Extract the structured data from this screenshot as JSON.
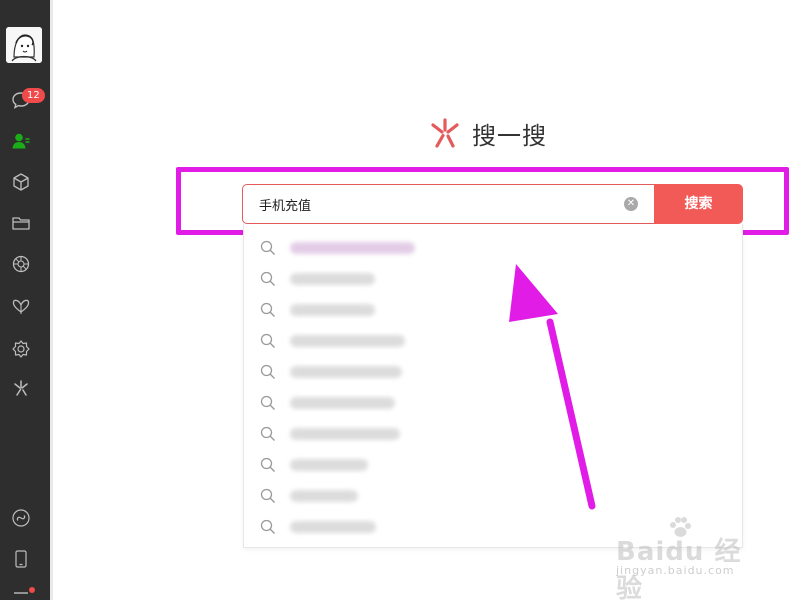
{
  "sidebar": {
    "unread_count": "12",
    "items": [
      {
        "icon": "chat-icon",
        "active": false
      },
      {
        "icon": "contacts-icon",
        "active": true
      },
      {
        "icon": "cube-icon",
        "active": false
      },
      {
        "icon": "folder-icon",
        "active": false
      },
      {
        "icon": "moments-icon",
        "active": false
      },
      {
        "icon": "butterfly-icon",
        "active": false
      },
      {
        "icon": "settings-cog-icon",
        "active": false
      },
      {
        "icon": "search-search-icon",
        "active": false
      }
    ],
    "bottom_items": [
      "mini-programs-icon",
      "phone-icon",
      "menu-icon"
    ]
  },
  "title": {
    "text": "搜一搜",
    "logo_color": "#e35b5b"
  },
  "search": {
    "value": "手机充值",
    "clear_glyph": "✕",
    "button_label": "搜索",
    "accent": "#f25a58",
    "highlight_color": "#e11ce6"
  },
  "suggestions": {
    "count": 10
  },
  "watermark": {
    "brand": "Baidu 经验",
    "domain": "jingyan.baidu.com"
  }
}
